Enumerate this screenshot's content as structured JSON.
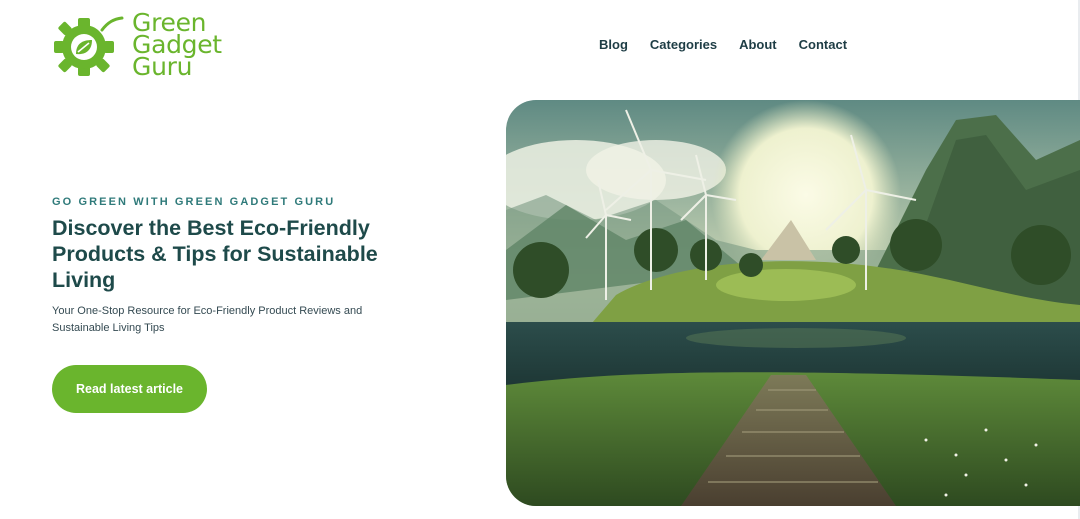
{
  "brand": {
    "name_lines": [
      "Green",
      "Gadget",
      "Guru"
    ],
    "logo_icon": "gear-leaf-icon",
    "accent_color": "#6ab52d"
  },
  "nav": {
    "items": [
      {
        "label": "Blog"
      },
      {
        "label": "Categories"
      },
      {
        "label": "About"
      },
      {
        "label": "Contact"
      }
    ]
  },
  "hero": {
    "eyebrow": "GO GREEN WITH GREEN GADGET GURU",
    "headline": "Discover the Best Eco-Friendly Products & Tips for Sustainable Living",
    "subtext": "Your One-Stop Resource for Eco-Friendly Product Reviews and Sustainable Living Tips",
    "cta_label": "Read latest article",
    "image_subject": "wind-turbines-landscape"
  },
  "colors": {
    "heading": "#1e4a4a",
    "eyebrow": "#2f7a7a",
    "nav_text": "#1e3d45"
  }
}
